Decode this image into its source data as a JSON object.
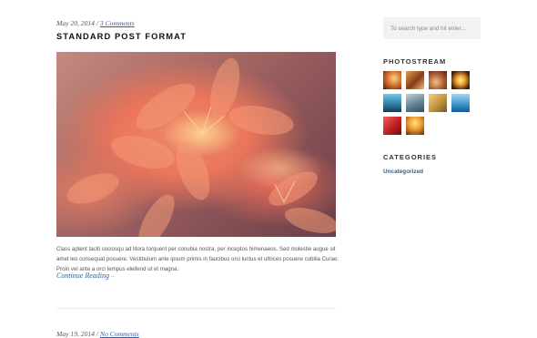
{
  "posts": [
    {
      "date": "May 20, 2014",
      "separator": " / ",
      "comments": "3 Comments",
      "title": "STANDARD POST FORMAT",
      "excerpt": "Class aptent taciti sociosqu ad litora torquent per conubia nostra, per inceptos himenaeos. Sed molestie augue sit amet leo consequat posuere. Vestibulum ante ipsum primis in faucibus orci luctus et ultrices posuere cubilia Curae; Proin vel ante a orci tempus eleifend ut et magna.",
      "read_more": "Continue Reading",
      "read_more_suffix": "→"
    },
    {
      "date": "May 19, 2014",
      "separator": " / ",
      "comments": "No Comments"
    }
  ],
  "sidebar": {
    "search_placeholder": "To search type and hit enter...",
    "photostream_title": "PHOTOSTREAM",
    "categories_title": "CATEGORIES",
    "categories": [
      "Uncategorized"
    ]
  },
  "colors": {
    "link": "#3a5a9a",
    "photos": [
      "#e8a040",
      "#d06a2a",
      "#c87a40",
      "#f0a030",
      "#3aa0c8",
      "#7a9ab0",
      "#c89a40",
      "#4a98d0",
      "#d03030",
      "#f09a30"
    ]
  }
}
